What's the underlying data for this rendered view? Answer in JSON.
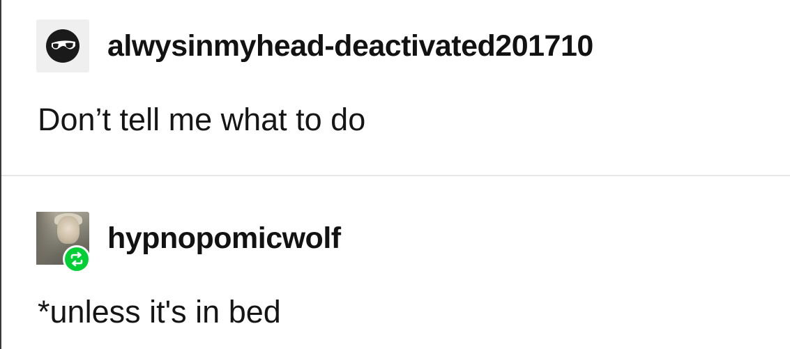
{
  "posts": [
    {
      "username": "alwysinmyhead-deactivated201710",
      "avatar_icon": "sunglasses-face-icon",
      "text": "Don’t tell me what to do"
    },
    {
      "username": "hypnopomicwolf",
      "avatar_icon": "user-photo",
      "badge_icon": "reblog-icon",
      "text": "*unless it's in bed"
    }
  ],
  "colors": {
    "background": "#ffffff",
    "text": "#121212",
    "divider": "#e6e6e6",
    "reblog_green": "#00cf35"
  }
}
